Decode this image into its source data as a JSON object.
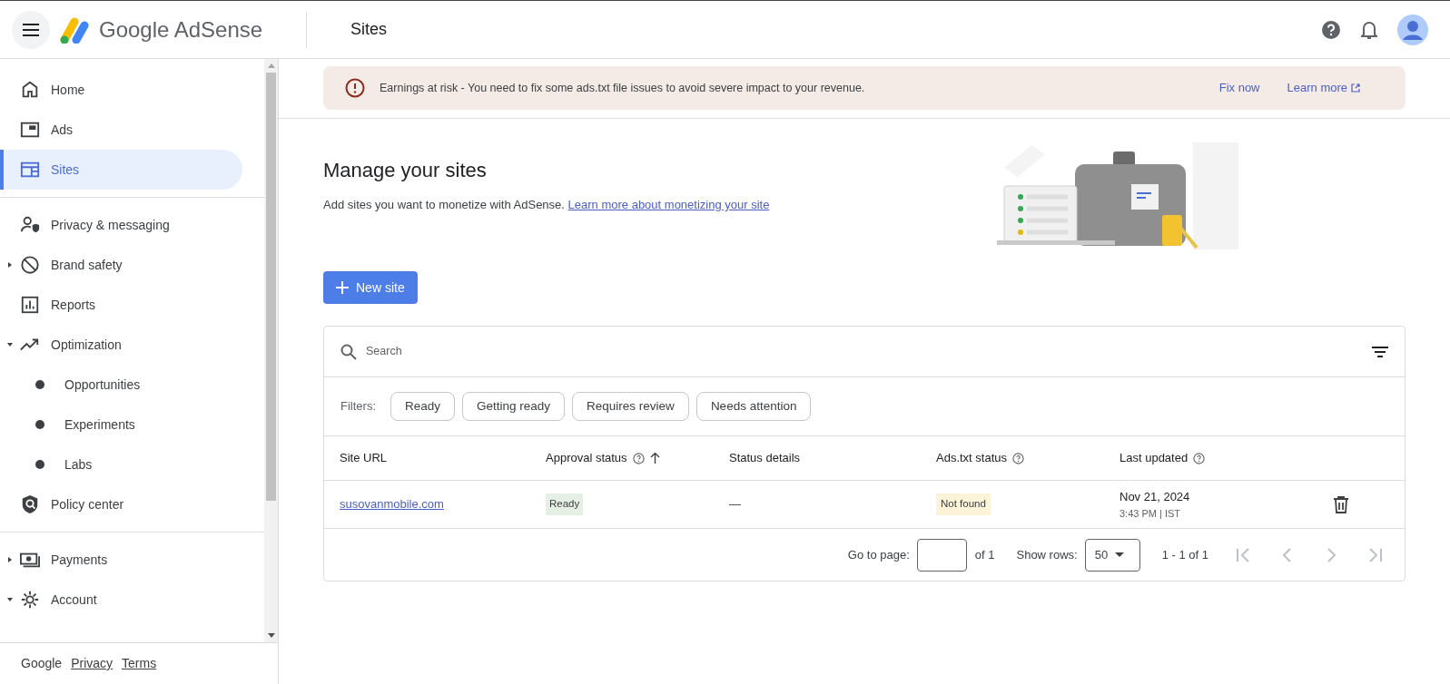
{
  "header": {
    "product": "Google AdSense",
    "page_title": "Sites"
  },
  "sidebar": {
    "sections": [
      {
        "items": [
          {
            "label": "Home",
            "kind": "item",
            "selected": false
          },
          {
            "label": "Ads",
            "kind": "item",
            "selected": false
          },
          {
            "label": "Sites",
            "kind": "item",
            "selected": true
          }
        ]
      },
      {
        "items": [
          {
            "label": "Privacy & messaging",
            "kind": "item",
            "selected": false
          },
          {
            "label": "Brand safety",
            "kind": "expandable",
            "expanded": false,
            "selected": false
          },
          {
            "label": "Reports",
            "kind": "item",
            "selected": false
          },
          {
            "label": "Optimization",
            "kind": "expandable",
            "expanded": true,
            "selected": false
          },
          {
            "label": "Opportunities",
            "kind": "sub",
            "selected": false
          },
          {
            "label": "Experiments",
            "kind": "sub",
            "selected": false
          },
          {
            "label": "Labs",
            "kind": "sub",
            "selected": false
          },
          {
            "label": "Policy center",
            "kind": "item",
            "selected": false
          }
        ]
      },
      {
        "items": [
          {
            "label": "Payments",
            "kind": "expandable",
            "expanded": false,
            "selected": false
          },
          {
            "label": "Account",
            "kind": "expandable",
            "expanded": true,
            "selected": false
          }
        ]
      }
    ],
    "footer": [
      "Google",
      "Privacy",
      "Terms"
    ]
  },
  "banner": {
    "message": "Earnings at risk - You need to fix some ads.txt file issues to avoid severe impact to your revenue.",
    "actions": [
      "Fix now",
      "Learn more"
    ]
  },
  "intro": {
    "title": "Manage your sites",
    "description": "Add sites you want to monetize with AdSense.",
    "link": "Learn more about monetizing your site"
  },
  "new_button": "New site",
  "table": {
    "search": {
      "placeholder": "Search"
    },
    "filters_label": "Filters:",
    "filters": [
      {
        "label": "Ready",
        "selected": false
      },
      {
        "label": "Getting ready",
        "selected": false
      },
      {
        "label": "Requires review",
        "selected": false
      },
      {
        "label": "Needs attention",
        "selected": false
      }
    ],
    "columns": [
      {
        "label": "Site URL",
        "help": false,
        "sorted": false
      },
      {
        "label": "Approval status",
        "help": true,
        "sorted": true
      },
      {
        "label": "Status details",
        "help": false,
        "sorted": false
      },
      {
        "label": "Ads.txt status",
        "help": true,
        "sorted": false
      },
      {
        "label": "Last updated",
        "help": true,
        "sorted": false
      }
    ],
    "rows": [
      {
        "site": "susovanmobile.com",
        "approval": "Ready",
        "details": "—",
        "ads_txt": "Not found",
        "date": "Nov 21, 2024",
        "time": "3:43 PM | IST"
      }
    ],
    "pagination": {
      "go_to_label": "Go to page:",
      "of_pages": "of 1",
      "rows_label": "Show rows:",
      "rows_value": "50",
      "range": "1 - 1 of 1"
    }
  }
}
